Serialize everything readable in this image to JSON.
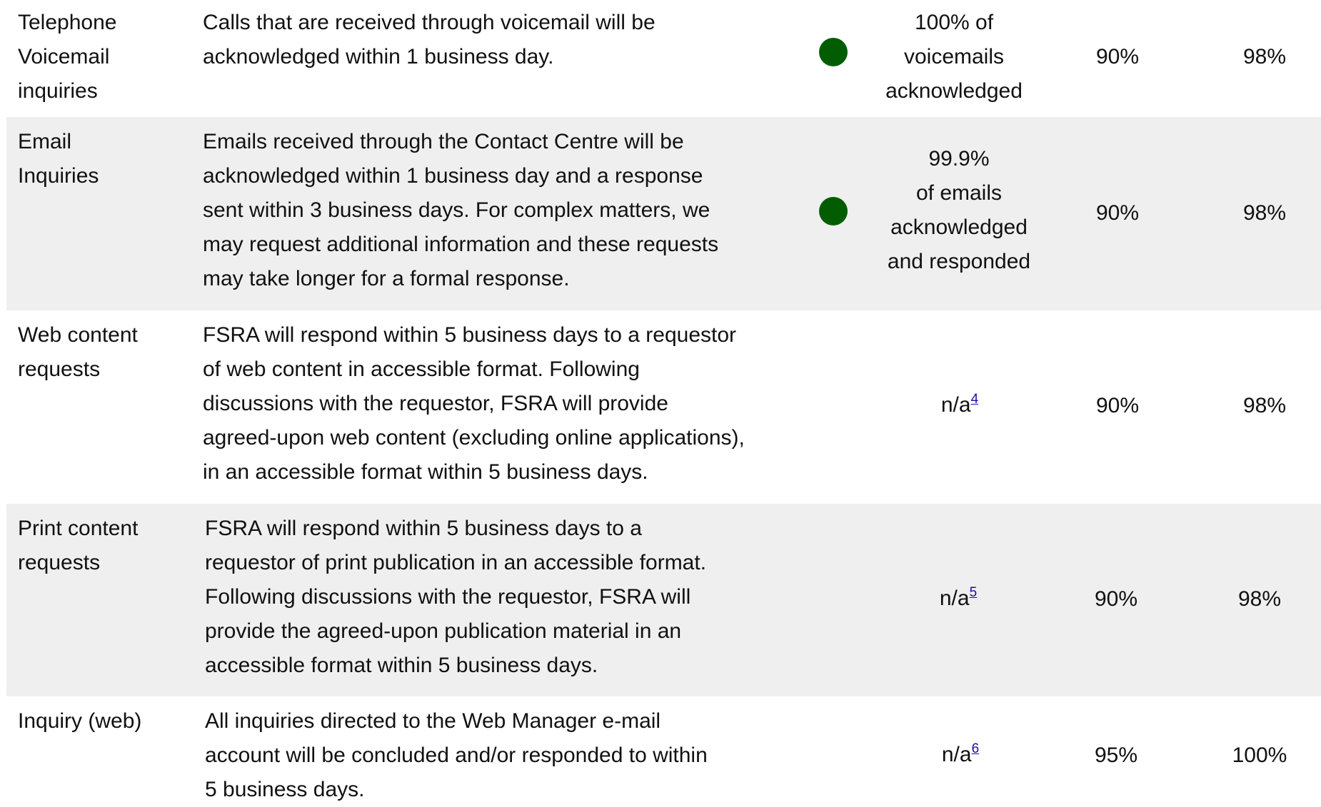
{
  "rows": [
    {
      "name_lines": [
        "Telephone",
        "Voicemail",
        "inquiries"
      ],
      "description_lines": [
        "Calls that are received through voicemail will be",
        "acknowledged within 1 business day."
      ],
      "status": "green",
      "result_lines": [
        "100% of",
        "voicemails",
        "acknowledged"
      ],
      "target": "90%",
      "actual": "98%"
    },
    {
      "name_lines": [
        "Email",
        "Inquiries"
      ],
      "description_lines": [
        "Emails received through the Contact Centre will be",
        "acknowledged within 1 business day and a response",
        "sent within 3 business days. For complex matters, we",
        "may request additional information and these requests",
        "may take longer for a formal response."
      ],
      "status": "green",
      "result_lines": [
        "99.9%",
        "of emails",
        "acknowledged",
        "and responded"
      ],
      "target": "90%",
      "actual": "98%"
    },
    {
      "name_lines": [
        "Web content",
        "requests"
      ],
      "description_lines": [
        "FSRA will respond within 5 business days to a requestor",
        "of web content in accessible format. Following",
        "discussions with the requestor, FSRA will provide",
        "agreed-upon web content (excluding online applications),",
        "in an accessible format within 5 business days."
      ],
      "result_text": "n/a",
      "result_footnote": "4",
      "target": "90%",
      "actual": "98%"
    },
    {
      "name_lines": [
        "Print content",
        "requests"
      ],
      "description_lines": [
        "FSRA will respond within 5 business days to a",
        "requestor of print publication in an accessible format.",
        "Following discussions with the requestor, FSRA will",
        "provide the agreed-upon publication material in an",
        "accessible format within 5 business days."
      ],
      "result_text": "n/a",
      "result_footnote": "5",
      "target": "90%",
      "actual": "98%"
    },
    {
      "name_lines": [
        "Inquiry (web)"
      ],
      "description_lines": [
        "All inquiries directed to the Web Manager e-mail",
        "account will be concluded and/or responded to within",
        "5 business days."
      ],
      "result_text": "n/a",
      "result_footnote": "6",
      "target": "95%",
      "actual": "100%"
    }
  ],
  "colors": {
    "status_green": "#025d02",
    "alt_row": "#efefef",
    "link": "#1a0dab"
  }
}
